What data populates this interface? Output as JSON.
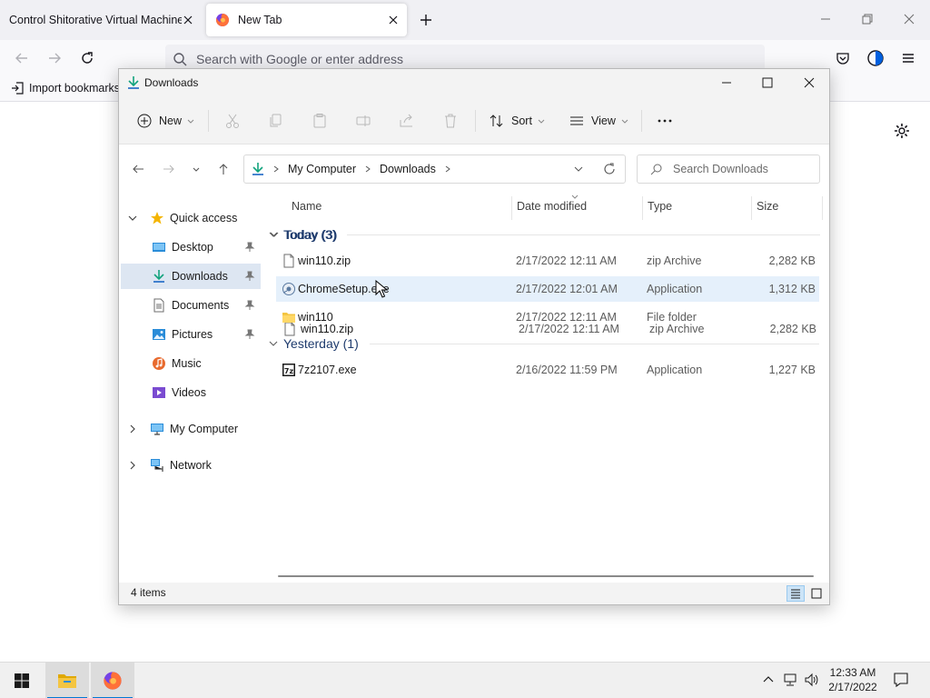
{
  "browser": {
    "tabs": [
      {
        "title": "Control Shitorative Virtual Machine",
        "active": false
      },
      {
        "title": "New Tab",
        "active": true
      }
    ],
    "urlbar_placeholder": "Search with Google or enter address",
    "bookmarks": {
      "import_label": "Import bookmarks"
    }
  },
  "explorer": {
    "title": "Downloads",
    "toolbar": {
      "new_label": "New",
      "sort_label": "Sort",
      "view_label": "View"
    },
    "breadcrumb": [
      "My Computer",
      "Downloads"
    ],
    "search_placeholder": "Search Downloads",
    "sidebar": {
      "quick_access": "Quick access",
      "items": [
        {
          "label": "Desktop",
          "pinned": true
        },
        {
          "label": "Downloads",
          "pinned": true,
          "selected": true
        },
        {
          "label": "Documents",
          "pinned": true
        },
        {
          "label": "Pictures",
          "pinned": true
        },
        {
          "label": "Music",
          "pinned": false
        },
        {
          "label": "Videos",
          "pinned": false
        }
      ],
      "my_computer": "My Computer",
      "network": "Network"
    },
    "columns": {
      "name": "Name",
      "date": "Date modified",
      "type": "Type",
      "size": "Size"
    },
    "groups": [
      {
        "label": "Today (3)",
        "files": [
          {
            "name": "win110.zip",
            "date": "2/17/2022 12:11 AM",
            "type": "zip Archive",
            "size": "2,282 KB"
          },
          {
            "name": "ChromeSetup.exe",
            "date": "2/17/2022 12:01 AM",
            "type": "Application",
            "size": "1,312 KB"
          },
          {
            "name": "win110",
            "date": "2/17/2022 12:11 AM",
            "type": "File folder",
            "size": ""
          }
        ]
      },
      {
        "label": "Yesterday (1)",
        "files": [
          {
            "name": "7z2107.exe",
            "date": "2/16/2022 11:59 PM",
            "type": "Application",
            "size": "1,227 KB"
          }
        ]
      }
    ],
    "status": "4 items"
  },
  "taskbar": {
    "time": "12:33 AM",
    "date": "2/17/2022"
  },
  "colors": {
    "accent": "#0078d4",
    "folder": "#f4c542",
    "selection": "#dde6f2",
    "hover": "#e5f0fb"
  }
}
